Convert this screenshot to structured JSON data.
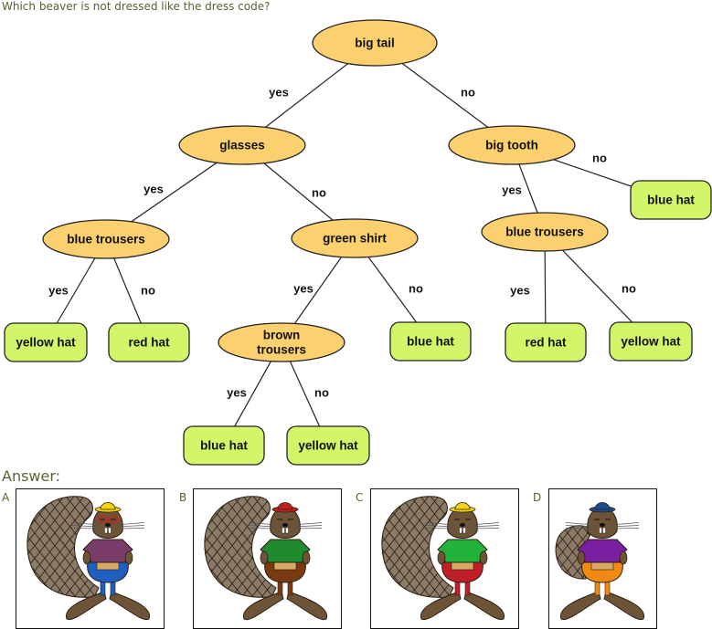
{
  "question": "Which beaver is not dressed like the dress code?",
  "colors": {
    "decision_fill": "#fbd06e",
    "leaf_fill": "#d3f56a",
    "stroke": "#222222",
    "text_accent": "#5a6233"
  },
  "tree": {
    "nodes": [
      {
        "id": "n1",
        "type": "decision",
        "label": "big tail"
      },
      {
        "id": "n2",
        "type": "decision",
        "label": "glasses"
      },
      {
        "id": "n3",
        "type": "decision",
        "label": "big tooth"
      },
      {
        "id": "n4",
        "type": "decision",
        "label": "blue trousers"
      },
      {
        "id": "n5",
        "type": "decision",
        "label": "green shirt"
      },
      {
        "id": "n6",
        "type": "leaf",
        "label": "blue hat"
      },
      {
        "id": "n7",
        "type": "decision",
        "label": "blue trousers"
      },
      {
        "id": "n8",
        "type": "leaf",
        "label": "yellow hat"
      },
      {
        "id": "n9",
        "type": "leaf",
        "label": "red hat"
      },
      {
        "id": "n10",
        "type": "decision",
        "label": "brown trousers"
      },
      {
        "id": "n11",
        "type": "leaf",
        "label": "blue hat"
      },
      {
        "id": "n12",
        "type": "leaf",
        "label": "red hat"
      },
      {
        "id": "n13",
        "type": "leaf",
        "label": "yellow hat"
      },
      {
        "id": "n14",
        "type": "leaf",
        "label": "blue hat"
      },
      {
        "id": "n15",
        "type": "leaf",
        "label": "yellow hat"
      }
    ],
    "edges": [
      {
        "from": "n1",
        "to": "n2",
        "label": "yes"
      },
      {
        "from": "n1",
        "to": "n3",
        "label": "no"
      },
      {
        "from": "n2",
        "to": "n4",
        "label": "yes"
      },
      {
        "from": "n2",
        "to": "n5",
        "label": "no"
      },
      {
        "from": "n3",
        "to": "n7",
        "label": "yes"
      },
      {
        "from": "n3",
        "to": "n6",
        "label": "no"
      },
      {
        "from": "n4",
        "to": "n8",
        "label": "yes"
      },
      {
        "from": "n4",
        "to": "n9",
        "label": "no"
      },
      {
        "from": "n5",
        "to": "n10",
        "label": "yes"
      },
      {
        "from": "n5",
        "to": "n11",
        "label": "no"
      },
      {
        "from": "n7",
        "to": "n12",
        "label": "yes"
      },
      {
        "from": "n7",
        "to": "n13",
        "label": "no"
      },
      {
        "from": "n10",
        "to": "n14",
        "label": "yes"
      },
      {
        "from": "n10",
        "to": "n15",
        "label": "no"
      }
    ]
  },
  "answer": {
    "heading": "Answer:",
    "options": [
      {
        "letter": "A",
        "tail": "big",
        "glasses": true,
        "hat_color": "#f2d312",
        "shirt_color": "#7a3d6a",
        "trousers_color": "#1f5fbf"
      },
      {
        "letter": "B",
        "tail": "big",
        "glasses": false,
        "hat_color": "#c0201f",
        "shirt_color": "#1f8a2e",
        "trousers_color": "#7a3a12"
      },
      {
        "letter": "C",
        "tail": "big",
        "glasses": false,
        "hat_color": "#f2d312",
        "shirt_color": "#22b33a",
        "trousers_color": "#c01f28"
      },
      {
        "letter": "D",
        "tail": "small",
        "glasses": false,
        "hat_color": "#1e4d8e",
        "shirt_color": "#7a1fa0",
        "trousers_color": "#f08a12"
      }
    ]
  }
}
